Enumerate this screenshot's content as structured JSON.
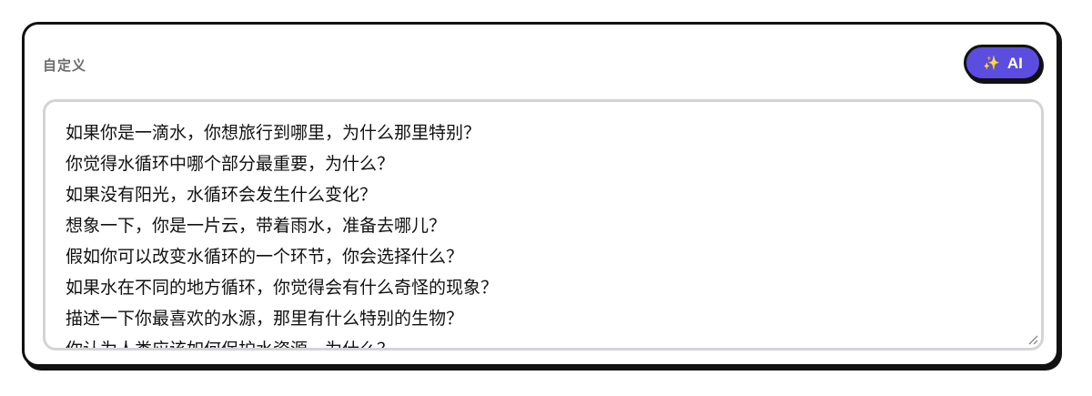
{
  "section": {
    "label": "自定义"
  },
  "ai_button": {
    "icon": "sparkles-icon",
    "label": "AI",
    "color": "#5b4de0"
  },
  "textarea": {
    "lines": [
      "如果你是一滴水，你想旅行到哪里，为什么那里特别？",
      "你觉得水循环中哪个部分最重要，为什么？",
      "如果没有阳光，水循环会发生什么变化？",
      "想象一下，你是一片云，带着雨水，准备去哪儿？",
      "假如你可以改变水循环的一个环节，你会选择什么？",
      "如果水在不同的地方循环，你觉得会有什么奇怪的现象？",
      "描述一下你最喜欢的水源，那里有什么特别的生物？",
      "你认为人类应该如何保护水资源，为什么？"
    ]
  }
}
